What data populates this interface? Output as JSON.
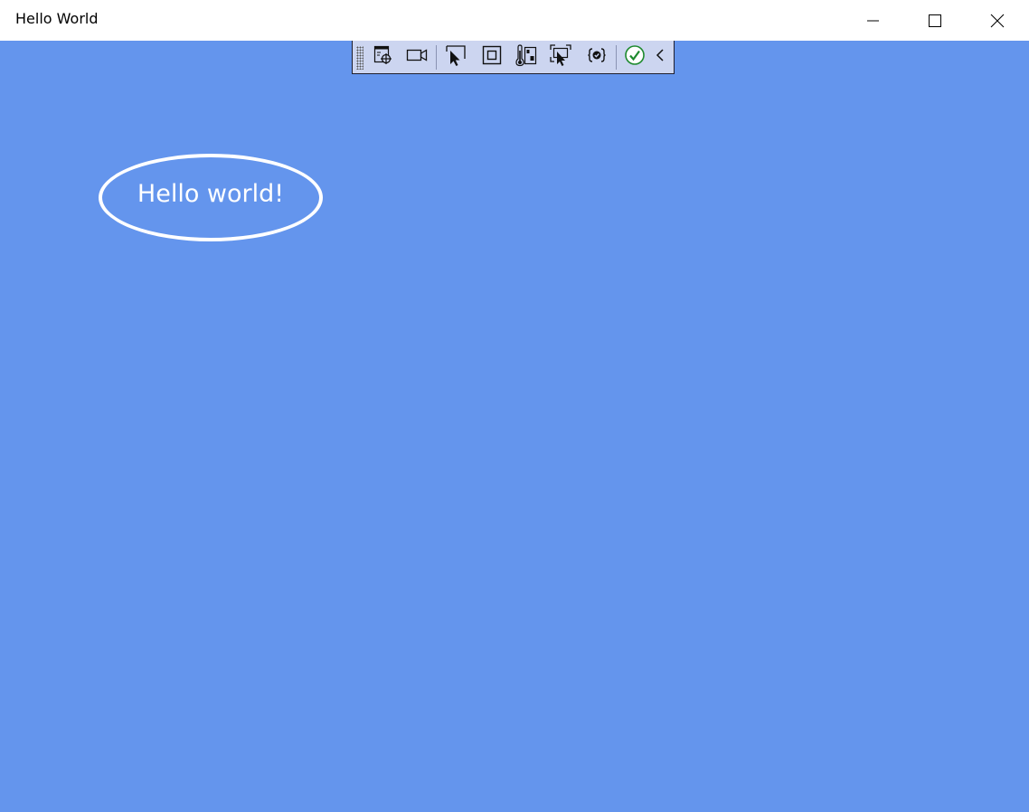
{
  "window": {
    "title": "Hello World",
    "background_color": "#6495ED"
  },
  "caption_buttons": [
    {
      "name": "minimize",
      "icon": "minimize-icon"
    },
    {
      "name": "maximize",
      "icon": "maximize-icon"
    },
    {
      "name": "close",
      "icon": "close-icon"
    }
  ],
  "debug_toolbar": {
    "background_color": "#CCD5F0",
    "buttons": [
      {
        "name": "go-to-live-visual-tree",
        "icon": "live-visual-tree-target-icon"
      },
      {
        "name": "track-focused-element",
        "icon": "video-camera-icon"
      },
      {
        "name": "select-element",
        "icon": "select-element-cursor-icon"
      },
      {
        "name": "display-layout-adorners",
        "icon": "layout-adorner-square-icon"
      },
      {
        "name": "show-performance-metrics",
        "icon": "thermometer-icon"
      },
      {
        "name": "preview-selection",
        "icon": "preview-selection-cursor-icon"
      },
      {
        "name": "binding-failures",
        "icon": "binding-braces-check-icon"
      },
      {
        "name": "hot-reload-status",
        "icon": "green-check-circle-icon"
      },
      {
        "name": "collapse-toolbar",
        "icon": "chevron-left-icon"
      }
    ]
  },
  "main": {
    "greeting_text": "Hello world!",
    "ellipse_stroke_color": "#FFFFFF"
  }
}
